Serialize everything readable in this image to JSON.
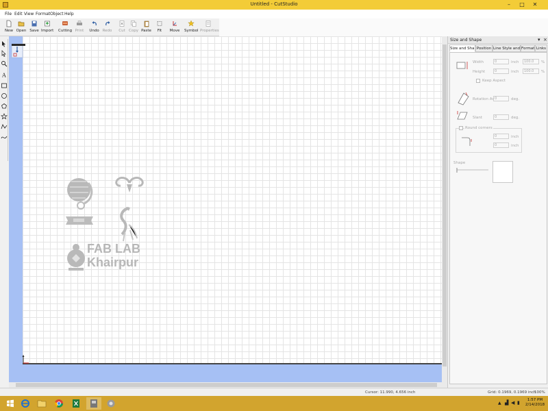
{
  "window": {
    "title": "Untitled - CutStudio"
  },
  "menu": [
    "File",
    "Edit",
    "View",
    "Format",
    "Object",
    "Help"
  ],
  "toolbar": {
    "new": "New",
    "open": "Open",
    "save": "Save",
    "import": "Import",
    "cutting": "Cutting",
    "print": "Print",
    "undo": "Undo",
    "redo": "Redo",
    "cut": "Cut",
    "copy": "Copy",
    "paste": "Paste",
    "fit": "Fit",
    "move": "Move",
    "symbol": "Symbol",
    "properties": "Properties"
  },
  "canvas": {
    "logo_text_1": "FAB LAB",
    "logo_text_2": "Khairpur"
  },
  "panel": {
    "title": "Size and Shape",
    "tabs": [
      "Size and Shape",
      "Position",
      "Line Style and C...",
      "Format",
      "Links"
    ],
    "width_label": "Width",
    "height_label": "Height",
    "width_value": "0",
    "height_value": "0",
    "width_unit": "inch",
    "height_unit": "inch",
    "width_pct": "100.0",
    "height_pct": "100.0",
    "pct_symbol": "%",
    "keep_aspect": "Keep Aspect",
    "rotation_label": "Rotation Angle",
    "rotation_value": "0",
    "rotation_unit": "deg.",
    "slant_label": "Slant",
    "slant_value": "0",
    "slant_unit": "deg.",
    "round_corners": "Round corners",
    "round_value_1": "0",
    "round_value_2": "0",
    "round_unit_1": "inch",
    "round_unit_2": "inch",
    "shape_label": "Shape"
  },
  "status": {
    "cursor": "Cursor: 11.990, 4.656 inch",
    "grid": "Grid: 0.1969, 0.1969 inch",
    "zoom": "100%"
  },
  "taskbar": {
    "time": "1:57 PM",
    "date": "2/14/2018"
  },
  "colors": {
    "titlebar": "#f3cc37",
    "ruler": "#a6c0f4",
    "taskbar": "#d2a42e"
  }
}
